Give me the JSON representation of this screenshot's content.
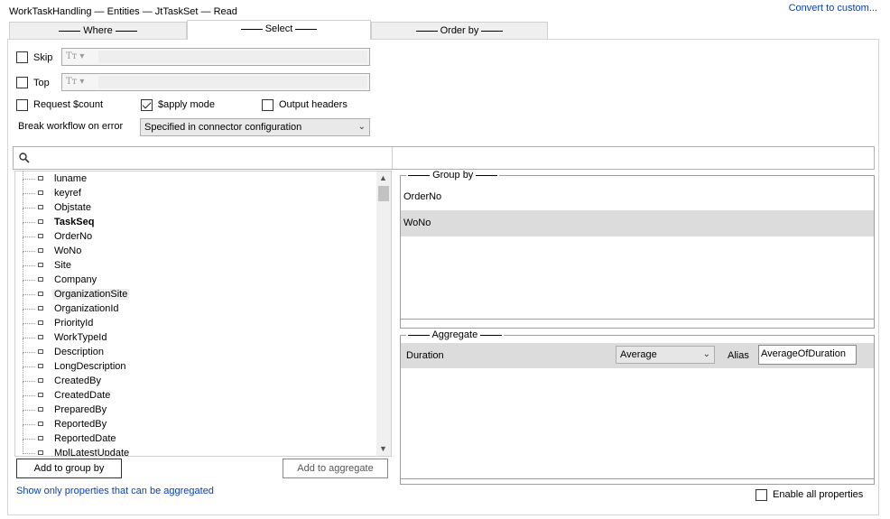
{
  "header": {
    "title": "WorkTaskHandling — Entities — JtTaskSet — Read",
    "convert_link": "Convert to custom..."
  },
  "tabs": [
    {
      "label": "Where"
    },
    {
      "label": "Select"
    },
    {
      "label": "Order by"
    }
  ],
  "options": {
    "skip_label": "Skip",
    "top_label": "Top",
    "type_icon": "Tт",
    "request_count_label": "Request $count",
    "apply_mode_label": "$apply mode",
    "output_headers_label": "Output headers",
    "break_workflow_label": "Break workflow on error",
    "break_workflow_value": "Specified in connector configuration"
  },
  "properties": [
    {
      "name": "luname"
    },
    {
      "name": "keyref"
    },
    {
      "name": "Objstate"
    },
    {
      "name": "TaskSeq"
    },
    {
      "name": "OrderNo"
    },
    {
      "name": "WoNo"
    },
    {
      "name": "Site"
    },
    {
      "name": "Company"
    },
    {
      "name": "OrganizationSite"
    },
    {
      "name": "OrganizationId"
    },
    {
      "name": "PriorityId"
    },
    {
      "name": "WorkTypeId"
    },
    {
      "name": "Description"
    },
    {
      "name": "LongDescription"
    },
    {
      "name": "CreatedBy"
    },
    {
      "name": "CreatedDate"
    },
    {
      "name": "PreparedBy"
    },
    {
      "name": "ReportedBy"
    },
    {
      "name": "ReportedDate"
    },
    {
      "name": "MplLatestUpdate"
    }
  ],
  "buttons": {
    "add_group_by": "Add to group by",
    "add_aggregate": "Add to aggregate"
  },
  "group_by": {
    "title": "Group by",
    "items": [
      "OrderNo",
      "WoNo"
    ]
  },
  "aggregate": {
    "title": "Aggregate",
    "field": "Duration",
    "function": "Average",
    "alias_label": "Alias",
    "alias_value": "AverageOfDuration"
  },
  "footer": {
    "show_only_link": "Show only properties that can be aggregated",
    "enable_all_label": "Enable all properties"
  }
}
